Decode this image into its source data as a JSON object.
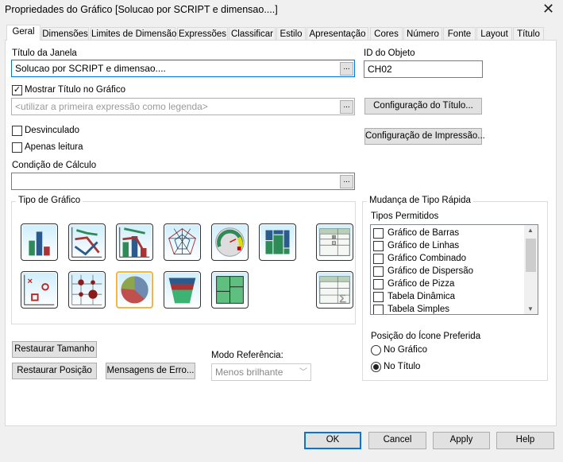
{
  "window": {
    "title": "Propriedades do Gráfico [Solucao por SCRIPT e dimensao....]"
  },
  "tabs": [
    "Geral",
    "Dimensões",
    "Limites de Dimensão",
    "Expressões",
    "Classificar",
    "Estilo",
    "Apresentação",
    "Cores",
    "Número",
    "Fonte",
    "Layout",
    "Título"
  ],
  "active_tab": "Geral",
  "general": {
    "window_title_label": "Título da Janela",
    "window_title_value": "Solucao por SCRIPT e dimensao....",
    "object_id_label": "ID do Objeto",
    "object_id_value": "CH02",
    "show_title_label": "Mostrar Título no Gráfico",
    "show_title_checked": true,
    "chart_title_placeholder": "<utilizar a primeira expressão como legenda>",
    "title_config_button": "Configuração do Título...",
    "print_config_button": "Configuração de Impressão...",
    "detached_label": "Desvinculado",
    "readonly_label": "Apenas leitura",
    "calc_condition_label": "Condição de Cálculo",
    "calc_condition_value": "",
    "ellipsis": "..."
  },
  "chart_type": {
    "label": "Tipo de Gráfico",
    "types": [
      "bar-chart",
      "line-chart",
      "combo-chart",
      "radar-chart",
      "gauge-chart",
      "block-chart",
      "pivot-table",
      "scatter-chart",
      "grid-chart",
      "pie-chart",
      "funnel-chart",
      "mekko-chart",
      "straight-table"
    ],
    "selected": "pie-chart"
  },
  "quick_change": {
    "label": "Mudança de Tipo Rápida",
    "allowed_label": "Tipos Permitidos",
    "items": [
      "Gráfico de Barras",
      "Gráfico de Linhas",
      "Gráfico Combinado",
      "Gráfico de Dispersão",
      "Gráfico de Pizza",
      "Tabela Dinâmica",
      "Tabela Simples"
    ],
    "icon_position_label": "Posição do Ícone Preferida",
    "positions": [
      "No Gráfico",
      "No Título"
    ],
    "selected_position": "No Título"
  },
  "restore_size_button": "Restaurar Tamanho",
  "restore_position_button": "Restaurar Posição",
  "error_messages_button": "Mensagens de Erro...",
  "reference_mode": {
    "label": "Modo Referência:",
    "value": "Menos brilhante"
  },
  "footer": {
    "ok": "OK",
    "cancel": "Cancel",
    "apply": "Apply",
    "help": "Help"
  }
}
